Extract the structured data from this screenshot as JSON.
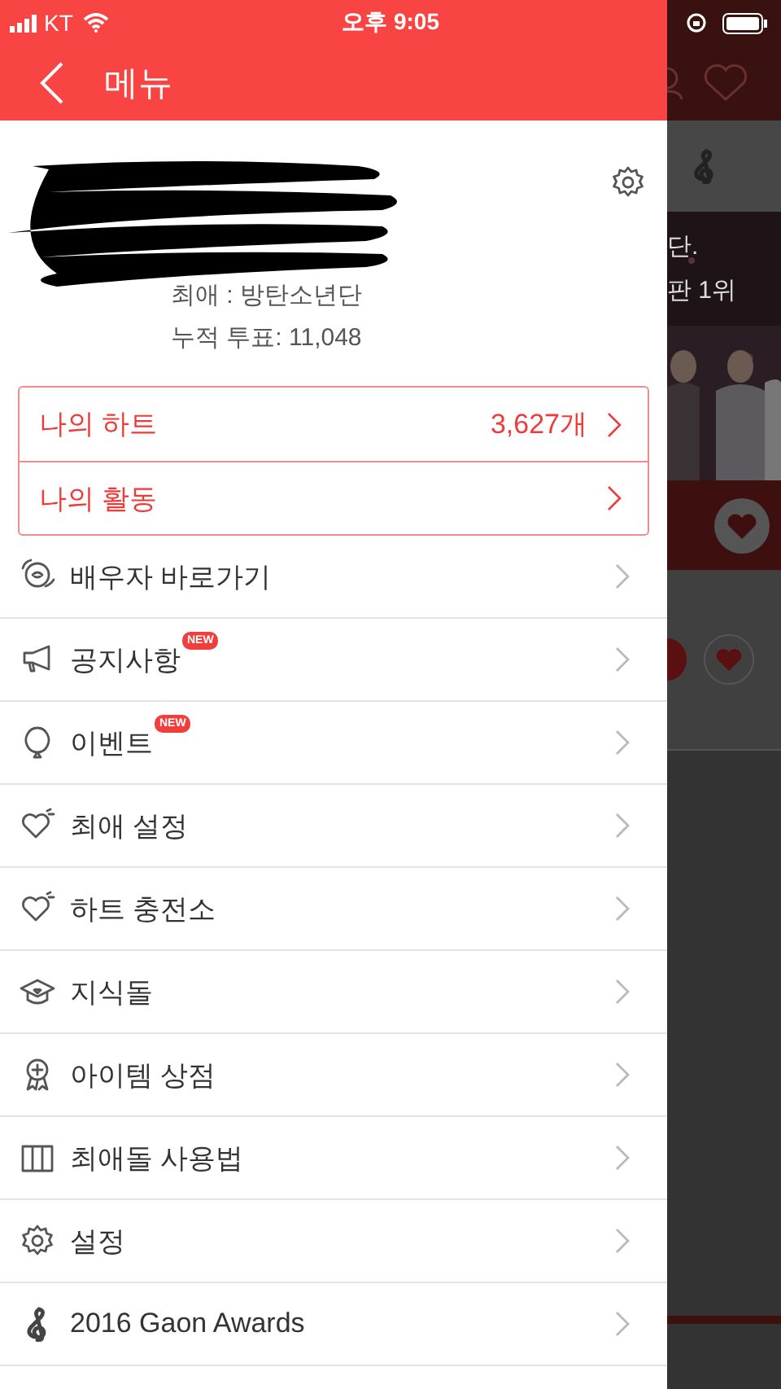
{
  "status_bar": {
    "carrier": "KT",
    "time": "오후 9:05"
  },
  "header": {
    "title": "메뉴"
  },
  "profile": {
    "favorite": "최애 : 방탄소년단",
    "votes": "누적 투표: 11,048"
  },
  "summary": [
    {
      "label": "나의 하트",
      "value": "3,627개"
    },
    {
      "label": "나의 활동"
    }
  ],
  "menu": [
    {
      "kind": "face",
      "label": "배우자 바로가기"
    },
    {
      "kind": "megaphone",
      "label": "공지사항",
      "badge": "NEW"
    },
    {
      "kind": "balloon",
      "label": "이벤트",
      "badge": "NEW"
    },
    {
      "kind": "heart",
      "label": "최애 설정"
    },
    {
      "kind": "heart",
      "label": "하트 충전소"
    },
    {
      "kind": "cap",
      "label": "지식돌"
    },
    {
      "kind": "medal",
      "label": "아이템 상점"
    },
    {
      "kind": "map",
      "label": "최애돌 사용법"
    },
    {
      "kind": "gear",
      "label": "설정"
    },
    {
      "kind": "clef",
      "label": "2016 Gaon Awards"
    }
  ],
  "background": {
    "lines": [
      "단.",
      "판 1위"
    ]
  }
}
